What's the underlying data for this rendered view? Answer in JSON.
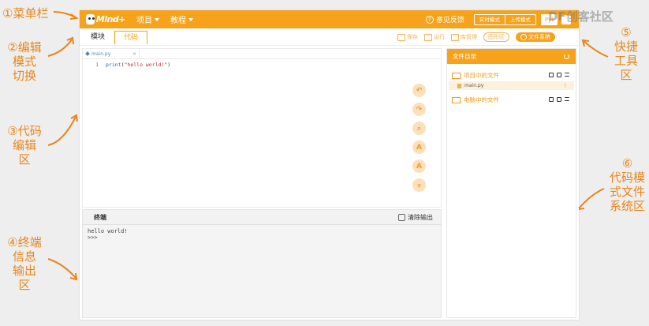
{
  "annotations": {
    "a1": "①菜单栏",
    "a2": [
      "②编辑",
      "模式",
      "切换"
    ],
    "a3": [
      "③代码",
      "编辑",
      "区"
    ],
    "a4": [
      "④终端",
      "信息",
      "输出",
      "区"
    ],
    "a5": [
      "⑤",
      "快捷",
      "工具",
      "区"
    ],
    "a6": [
      "⑥",
      "代码模",
      "式文件",
      "系统区"
    ]
  },
  "menubar": {
    "logo_text": "Mind+",
    "project_label": "项目",
    "tutorial_label": "教程",
    "feedback_label": "意见反馈",
    "mode_realtime": "实时模式",
    "mode_upload": "上传模式",
    "language_label": "Pyt"
  },
  "watermark": "DF创客社区",
  "toolbar": {
    "tab_block": "模块",
    "tab_code": "代码",
    "save": "保存",
    "run": "运行",
    "library": "库管理",
    "graphics": "图形区",
    "filesystem": "文件系统"
  },
  "editor": {
    "file_tab": "main.py",
    "line_number": "1",
    "code_fn": "print",
    "code_arg": "\"hello world!\""
  },
  "terminal": {
    "title": "终端",
    "clear_label": "清除输出",
    "output_line1": "hello world!",
    "output_line2": ">>>"
  },
  "files": {
    "header": "文件目录",
    "project_files": "项目中的文件",
    "main_file": "main.py",
    "computer_files": "电脑中的文件"
  },
  "colors": {
    "accent": "#f7a21b",
    "annotation": "#e8861a"
  }
}
